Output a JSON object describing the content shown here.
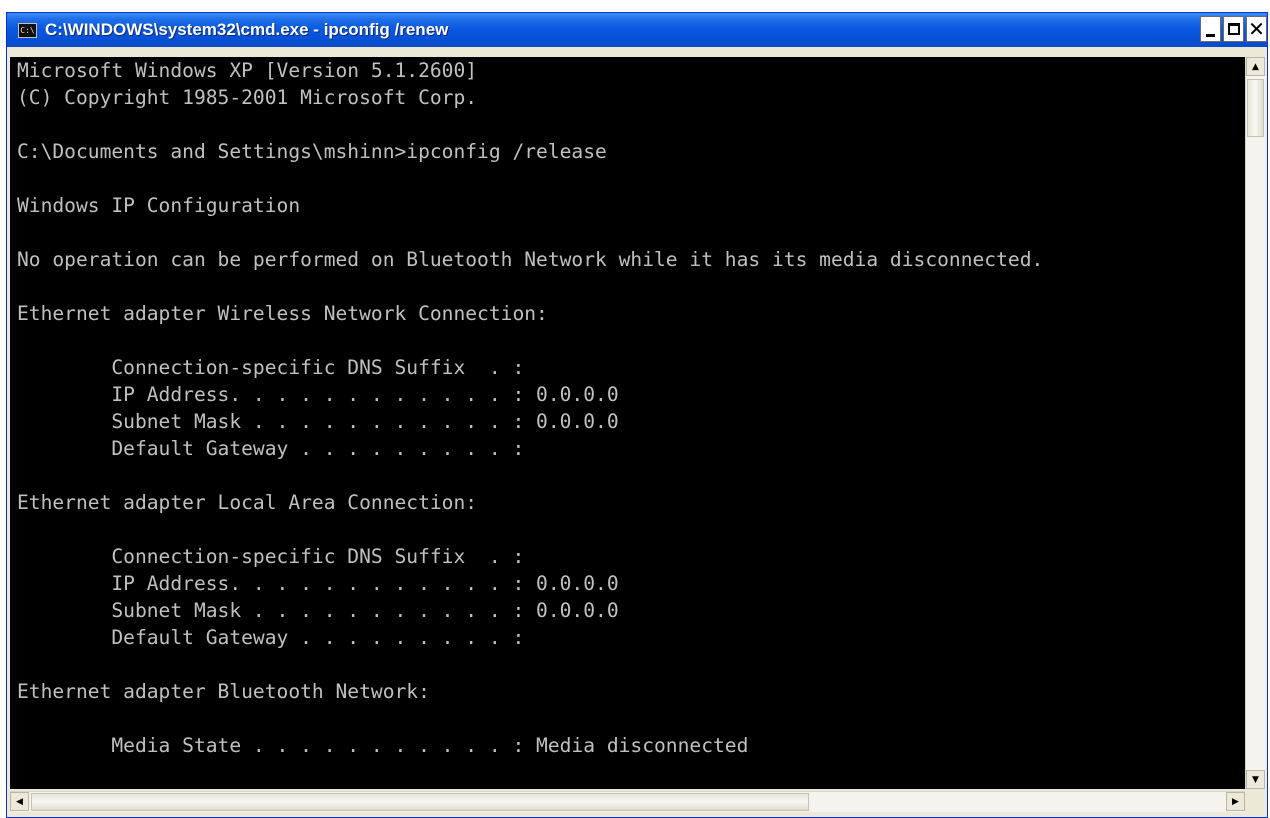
{
  "window": {
    "title": "C:\\WINDOWS\\system32\\cmd.exe - ipconfig /renew",
    "icon_name": "cmd-icon",
    "icon_text": "C:\\",
    "buttons": {
      "minimize": "minimize-icon",
      "maximize": "maximize-icon",
      "close": "close-icon",
      "close_glyph": "✕"
    }
  },
  "console": {
    "text_color": "#c0c0c0",
    "background": "#000000",
    "lines": [
      "Microsoft Windows XP [Version 5.1.2600]",
      "(C) Copyright 1985-2001 Microsoft Corp.",
      "",
      "C:\\Documents and Settings\\mshinn>ipconfig /release",
      "",
      "Windows IP Configuration",
      "",
      "No operation can be performed on Bluetooth Network while it has its media disconnected.",
      "",
      "Ethernet adapter Wireless Network Connection:",
      "",
      "        Connection-specific DNS Suffix  . :",
      "        IP Address. . . . . . . . . . . . : 0.0.0.0",
      "        Subnet Mask . . . . . . . . . . . : 0.0.0.0",
      "        Default Gateway . . . . . . . . . :",
      "",
      "Ethernet adapter Local Area Connection:",
      "",
      "        Connection-specific DNS Suffix  . :",
      "        IP Address. . . . . . . . . . . . : 0.0.0.0",
      "        Subnet Mask . . . . . . . . . . . : 0.0.0.0",
      "        Default Gateway . . . . . . . . . :",
      "",
      "Ethernet adapter Bluetooth Network:",
      "",
      "        Media State . . . . . . . . . . . : Media disconnected"
    ]
  },
  "scrollbars": {
    "up_arrow": "▲",
    "down_arrow": "▼",
    "left_arrow": "◀",
    "right_arrow": "▶"
  }
}
